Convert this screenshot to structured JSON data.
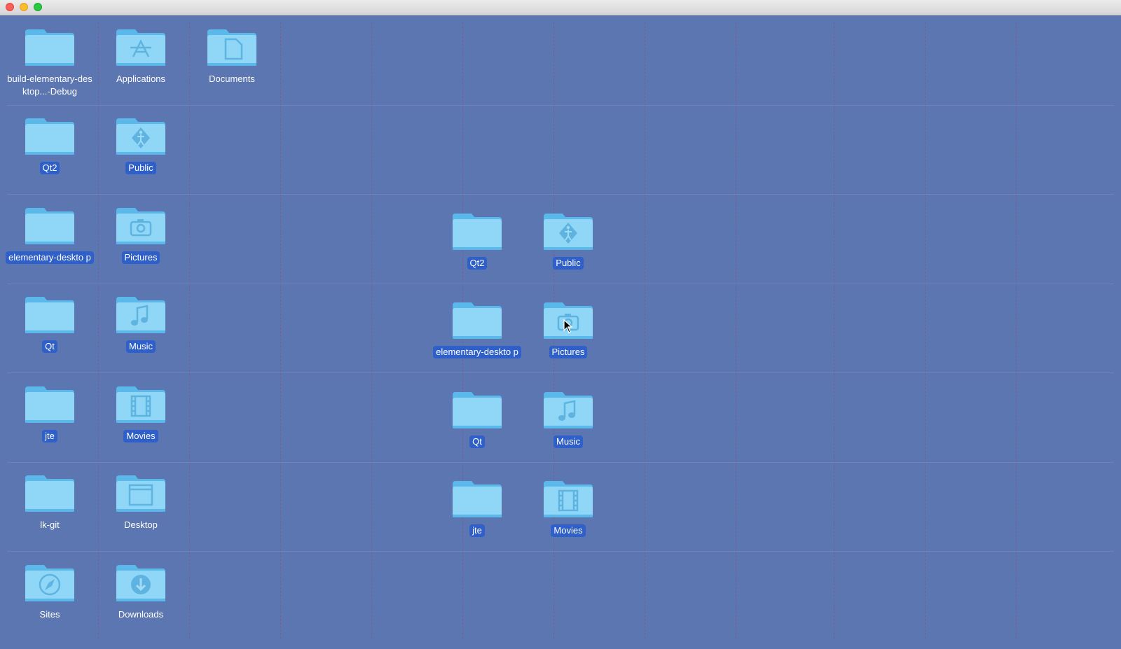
{
  "window": {
    "buttons": [
      "close",
      "minimize",
      "zoom"
    ]
  },
  "desktop": {
    "left_icons": [
      {
        "label": "build-elementary-desktop...-Debug",
        "icon": "folder-icon",
        "selected": false
      },
      {
        "label": "Applications",
        "icon": "applications-folder-icon",
        "selected": false
      },
      {
        "label": "Documents",
        "icon": "documents-folder-icon",
        "selected": false
      },
      {
        "label": "Qt2",
        "icon": "folder-icon",
        "selected": true
      },
      {
        "label": "Public",
        "icon": "public-folder-icon",
        "selected": true
      },
      {
        "label": "elementary-deskto p",
        "icon": "folder-icon",
        "selected": true
      },
      {
        "label": "Pictures",
        "icon": "pictures-folder-icon",
        "selected": true
      },
      {
        "label": "Qt",
        "icon": "folder-icon",
        "selected": true
      },
      {
        "label": "Music",
        "icon": "music-folder-icon",
        "selected": true
      },
      {
        "label": "jte",
        "icon": "folder-icon",
        "selected": true
      },
      {
        "label": "Movies",
        "icon": "movies-folder-icon",
        "selected": true
      },
      {
        "label": "lk-git",
        "icon": "folder-icon",
        "selected": false
      },
      {
        "label": "Desktop",
        "icon": "desktop-folder-icon",
        "selected": false
      },
      {
        "label": "Sites",
        "icon": "sites-folder-icon",
        "selected": false
      },
      {
        "label": "Downloads",
        "icon": "downloads-folder-icon",
        "selected": false
      }
    ],
    "drag_icons": [
      {
        "label": "Qt2",
        "icon": "folder-icon"
      },
      {
        "label": "Public",
        "icon": "public-folder-icon"
      },
      {
        "label": "elementary-deskto p",
        "icon": "folder-icon"
      },
      {
        "label": "Pictures",
        "icon": "pictures-folder-icon"
      },
      {
        "label": "Qt",
        "icon": "folder-icon"
      },
      {
        "label": "Music",
        "icon": "music-folder-icon"
      },
      {
        "label": "jte",
        "icon": "folder-icon"
      },
      {
        "label": "Movies",
        "icon": "movies-folder-icon"
      }
    ]
  },
  "colors": {
    "desktop_bg": "#5b76b0",
    "folder_light": "#8fd6f7",
    "folder_dark": "#5bb8ea",
    "selection": "#2f5fc9"
  }
}
